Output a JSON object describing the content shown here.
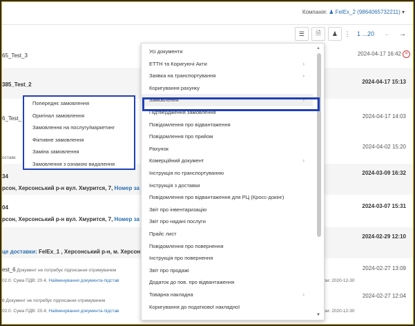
{
  "header": {
    "company_label": "Компанія:",
    "company_value": "FelEx_2 (9864065732211)",
    "pager_text": "1 ...20"
  },
  "rows": [
    {
      "text": "65_Test_3",
      "date": "2024-04-17 16:42"
    },
    {
      "text": "385_Test_2",
      "date": "2024-04-17 15:13"
    },
    {
      "text": "6_Test_",
      "date": "2024-04-17 14:03"
    },
    {
      "text": "оставк",
      "date": "2024-04-02 15:20"
    },
    {
      "text1": "34",
      "text2": "рсон, Херсонський р-н вул. Хмурится, 7,",
      "text3": " Номер за",
      "date": "2024-03-09 16:32"
    },
    {
      "text1": "04",
      "text2": "рсон, Херсонський р-н вул. Хмурится, 7,",
      "text3": " Номер за",
      "date": "2024-03-07 15:31"
    },
    {
      "text1": "це доставки:",
      "text2": " FelEx_1 , Херсонський р-н, м. Херсон в",
      "date": "2024-02-29 12:10"
    },
    {
      "text1": "est_6",
      "text2": " Документ не потребує підписання отримувачем",
      "text3": "02.0. Сума ПДВ: 20.4, ",
      "text4": "Найменування документа-підстав",
      "text5": "зи: 2020-12-30",
      "date": "2024-02-27 13:09"
    },
    {
      "text1": "6",
      "text2": " Документ не потребує підписання отримувачем",
      "text3": "02.0. Сума ПДВ: 20.4, ",
      "text4": "Найменування документа-підстав",
      "text5": "зи: 2020-12-30",
      "date": "2024-02-27 12:04"
    }
  ],
  "menu": {
    "items": [
      {
        "label": "Усі документи",
        "sub": false
      },
      {
        "label": "ЕТТН та Коригуючі Акти",
        "sub": true
      },
      {
        "label": "Заявка на транспортування",
        "sub": true
      },
      {
        "label": "Коригування рахунку",
        "sub": false
      },
      {
        "label": "Замовлення",
        "sub": true
      },
      {
        "label": "Підтвердження замовлення",
        "sub": false
      },
      {
        "label": "Повідомлення про відвантаження",
        "sub": false
      },
      {
        "label": "Повідомлення про прийом",
        "sub": false
      },
      {
        "label": "Рахунок",
        "sub": false
      },
      {
        "label": "Комерційний документ",
        "sub": true
      },
      {
        "label": "Інструкція по транспортуванню",
        "sub": false
      },
      {
        "label": "Інструкція з доставки",
        "sub": false
      },
      {
        "label": "Повідомлення про відвантаження для РЦ (Кросс-докінг)",
        "sub": false
      },
      {
        "label": "Звіт про інвентаризацію",
        "sub": false
      },
      {
        "label": "Звіт про надані послуги",
        "sub": false
      },
      {
        "label": "Прайс лист",
        "sub": false
      },
      {
        "label": "Повідомлення про повернення",
        "sub": false
      },
      {
        "label": "Інструкція про повернення",
        "sub": false
      },
      {
        "label": "Звіт про продажі",
        "sub": false
      },
      {
        "label": "Додаток до пов. про відвантаження",
        "sub": false
      },
      {
        "label": "Товарна накладна",
        "sub": true
      },
      {
        "label": "Коригування до податкової накладної",
        "sub": false
      }
    ]
  },
  "submenu": {
    "items": [
      {
        "label": "Попереднє замовлення"
      },
      {
        "label": "Оригінал замовлення"
      },
      {
        "label": "Замовлення на послугу/маркетинг"
      },
      {
        "label": "Фіктивне замовлення"
      },
      {
        "label": "Заміна замовлення"
      },
      {
        "label": "Замовлення з ознакою видалення"
      }
    ]
  },
  "colors": {
    "accent": "#1f3fb8",
    "link": "#2a6fb0",
    "frame": "#f0c000"
  }
}
